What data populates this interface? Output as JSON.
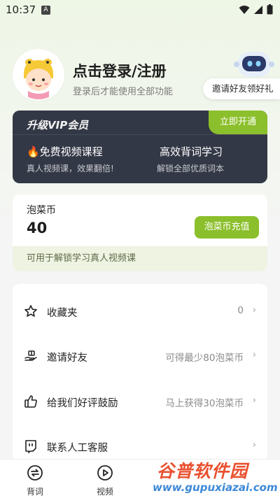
{
  "status_bar": {
    "time": "10:37",
    "notification_badge": "A"
  },
  "profile": {
    "login_title": "点击登录/注册",
    "login_subtitle": "登录后才能使用全部功能",
    "invite_label": "邀请好友领好礼"
  },
  "vip": {
    "title": "升级VIP会员",
    "open_button": "立即开通",
    "features": [
      {
        "title": "🔥免费视频课程",
        "subtitle": "真人视频课，效果翻倍!"
      },
      {
        "title": "高效背词学习",
        "subtitle": "解锁全部优质词本"
      }
    ]
  },
  "coins": {
    "label": "泡菜币",
    "value": "40",
    "recharge_button": "泡菜币充值",
    "footer_note": "可用于解锁学习真人视频课"
  },
  "menu": {
    "items": [
      {
        "label": "收藏夹",
        "value": "0",
        "icon": "star-icon"
      },
      {
        "label": "邀请好友",
        "value": "可得最少80泡菜币",
        "icon": "gift-hand-icon"
      },
      {
        "label": "给我们好评鼓励",
        "value": "马上获得30泡菜币",
        "icon": "thumbs-up-icon"
      },
      {
        "label": "联系人工客服",
        "value": "",
        "icon": "support-chat-icon"
      }
    ]
  },
  "tabbar": {
    "tabs": [
      {
        "label": "背词",
        "icon": "swap-circle-icon"
      },
      {
        "label": "视频",
        "icon": "play-circle-icon"
      }
    ]
  },
  "watermark": {
    "brand": "谷普软件园",
    "url": "www.gupuxiazai.com"
  },
  "colors": {
    "accent_green": "#8bbf2b",
    "vip_card_bg": "#333846",
    "coin_footer_bg": "#eef3e2"
  }
}
